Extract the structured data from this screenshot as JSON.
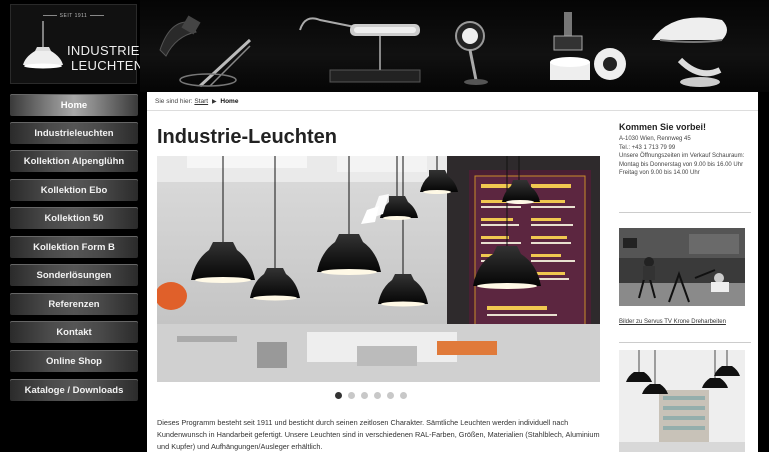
{
  "logo": {
    "since": "SEIT 1911",
    "line1": "INDUSTRIE",
    "line2": "LEUCHTEN"
  },
  "nav": {
    "items": [
      {
        "label": "Home",
        "active": true
      },
      {
        "label": "Industrieleuchten"
      },
      {
        "label": "Kollektion Alpenglühn"
      },
      {
        "label": "Kollektion Ebo"
      },
      {
        "label": "Kollektion 50"
      },
      {
        "label": "Kollektion Form B"
      },
      {
        "label": "Sonderlösungen"
      },
      {
        "label": "Referenzen"
      },
      {
        "label": "Kontakt"
      },
      {
        "label": "Online Shop"
      },
      {
        "label": "Kataloge / Downloads"
      }
    ]
  },
  "breadcrumb": {
    "prefix": "Sie sind hier:",
    "start": "Start",
    "current": "Home"
  },
  "main": {
    "title": "Industrie-Leuchten",
    "slider": {
      "count": 6,
      "active_index": 0
    },
    "body": "Dieses Programm besteht seit 1911 und besticht durch seinen zeitlosen Charakter. Sämtliche Leuchten werden individuell nach Kundenwunsch in Handarbeit gefertigt. Unsere Leuchten sind in verschiedenen RAL-Farben, Größen, Materialien (Stahlblech, Aluminium und Kupfer) und Aufhängungen/Ausleger erhältlich."
  },
  "aside": {
    "heading": "Kommen Sie vorbei!",
    "address": "A-1030 Wien, Rennweg 45",
    "phone": "Tel.: +43 1 713 79 99",
    "hours": "Unsere Öffnungszeiten im Verkauf Schauraum: Montag bis Donnerstag von 9.00 bis 16.00 Uhr Freitag von 9.00 bis 14.00 Uhr",
    "caption": "Bilder zu Servus TV Krone Dreharbeiten"
  },
  "colors": {
    "background": "#000000",
    "content_bg": "#ffffff",
    "nav_active": "#a8a8a8"
  }
}
